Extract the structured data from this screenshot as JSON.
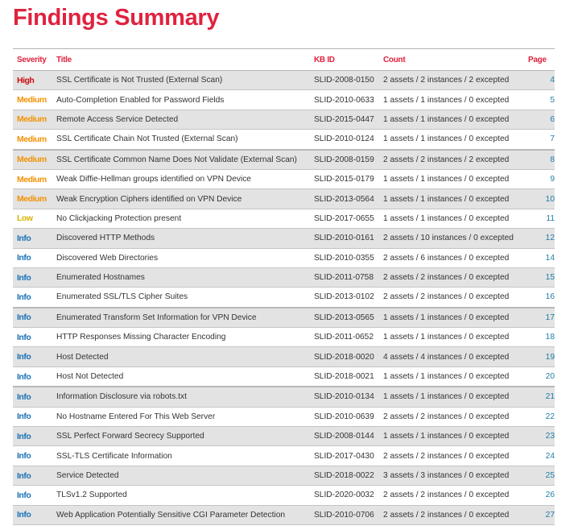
{
  "page_title": "Findings Summary",
  "colors": {
    "title": "#e0223f",
    "header": "#e0223f",
    "High": "#cc0a10",
    "Medium": "#f39200",
    "Low": "#d9b200",
    "Info": "#1a72b8",
    "page_link": "#1e7ea6"
  },
  "table": {
    "headers": {
      "severity": "Severity",
      "title": "Title",
      "kb_id": "KB ID",
      "count": "Count",
      "page": "Page"
    },
    "rows": [
      {
        "severity": "High",
        "title": "SSL Certificate is Not Trusted (External Scan)",
        "kb_id": "SLID-2008-0150",
        "count": "2 assets / 2 instances / 2 excepted",
        "page": "4"
      },
      {
        "severity": "Medium",
        "title": "Auto-Completion Enabled for Password Fields",
        "kb_id": "SLID-2010-0633",
        "count": "1 assets / 1 instances / 0 excepted",
        "page": "5"
      },
      {
        "severity": "Medium",
        "title": "Remote Access Service Detected",
        "kb_id": "SLID-2015-0447",
        "count": "1 assets / 1 instances / 0 excepted",
        "page": "6"
      },
      {
        "severity": "Medium",
        "title": "SSL Certificate Chain Not Trusted (External Scan)",
        "kb_id": "SLID-2010-0124",
        "count": "1 assets / 1 instances / 0 excepted",
        "page": "7"
      },
      {
        "severity": "Medium",
        "title": "SSL Certificate Common Name Does Not Validate (External Scan)",
        "kb_id": "SLID-2008-0159",
        "count": "2 assets / 2 instances / 2 excepted",
        "page": "8"
      },
      {
        "severity": "Medium",
        "title": "Weak Diffie-Hellman groups identified on VPN Device",
        "kb_id": "SLID-2015-0179",
        "count": "1 assets / 1 instances / 0 excepted",
        "page": "9"
      },
      {
        "severity": "Medium",
        "title": "Weak Encryption Ciphers identified on VPN Device",
        "kb_id": "SLID-2013-0564",
        "count": "1 assets / 1 instances / 0 excepted",
        "page": "10"
      },
      {
        "severity": "Low",
        "title": "No Clickjacking Protection present",
        "kb_id": "SLID-2017-0655",
        "count": "1 assets / 1 instances / 0 excepted",
        "page": "11"
      },
      {
        "severity": "Info",
        "title": "Discovered HTTP Methods",
        "kb_id": "SLID-2010-0161",
        "count": "2 assets / 10 instances / 0 excepted",
        "page": "12"
      },
      {
        "severity": "Info",
        "title": "Discovered Web Directories",
        "kb_id": "SLID-2010-0355",
        "count": "2 assets / 6 instances / 0 excepted",
        "page": "14"
      },
      {
        "severity": "Info",
        "title": "Enumerated Hostnames",
        "kb_id": "SLID-2011-0758",
        "count": "2 assets / 2 instances / 0 excepted",
        "page": "15"
      },
      {
        "severity": "Info",
        "title": "Enumerated SSL/TLS Cipher Suites",
        "kb_id": "SLID-2013-0102",
        "count": "2 assets / 2 instances / 0 excepted",
        "page": "16"
      },
      {
        "severity": "Info",
        "title": "Enumerated Transform Set Information for VPN Device",
        "kb_id": "SLID-2013-0565",
        "count": "1 assets / 1 instances / 0 excepted",
        "page": "17"
      },
      {
        "severity": "Info",
        "title": "HTTP Responses Missing Character Encoding",
        "kb_id": "SLID-2011-0652",
        "count": "1 assets / 1 instances / 0 excepted",
        "page": "18"
      },
      {
        "severity": "Info",
        "title": "Host Detected",
        "kb_id": "SLID-2018-0020",
        "count": "4 assets / 4 instances / 0 excepted",
        "page": "19"
      },
      {
        "severity": "Info",
        "title": "Host Not Detected",
        "kb_id": "SLID-2018-0021",
        "count": "1 assets / 1 instances / 0 excepted",
        "page": "20"
      },
      {
        "severity": "Info",
        "title": "Information Disclosure via robots.txt",
        "kb_id": "SLID-2010-0134",
        "count": "1 assets / 1 instances / 0 excepted",
        "page": "21"
      },
      {
        "severity": "Info",
        "title": "No Hostname Entered For This Web Server",
        "kb_id": "SLID-2010-0639",
        "count": "2 assets / 2 instances / 0 excepted",
        "page": "22"
      },
      {
        "severity": "Info",
        "title": "SSL Perfect Forward Secrecy Supported",
        "kb_id": "SLID-2008-0144",
        "count": "1 assets / 1 instances / 0 excepted",
        "page": "23"
      },
      {
        "severity": "Info",
        "title": "SSL-TLS Certificate Information",
        "kb_id": "SLID-2017-0430",
        "count": "2 assets / 2 instances / 0 excepted",
        "page": "24"
      },
      {
        "severity": "Info",
        "title": "Service Detected",
        "kb_id": "SLID-2018-0022",
        "count": "3 assets / 3 instances / 0 excepted",
        "page": "25"
      },
      {
        "severity": "Info",
        "title": "TLSv1.2 Supported",
        "kb_id": "SLID-2020-0032",
        "count": "2 assets / 2 instances / 0 excepted",
        "page": "26"
      },
      {
        "severity": "Info",
        "title": "Web Application Potentially Sensitive CGI Parameter Detection",
        "kb_id": "SLID-2010-0706",
        "count": "2 assets / 2 instances / 0 excepted",
        "page": "27"
      }
    ]
  }
}
